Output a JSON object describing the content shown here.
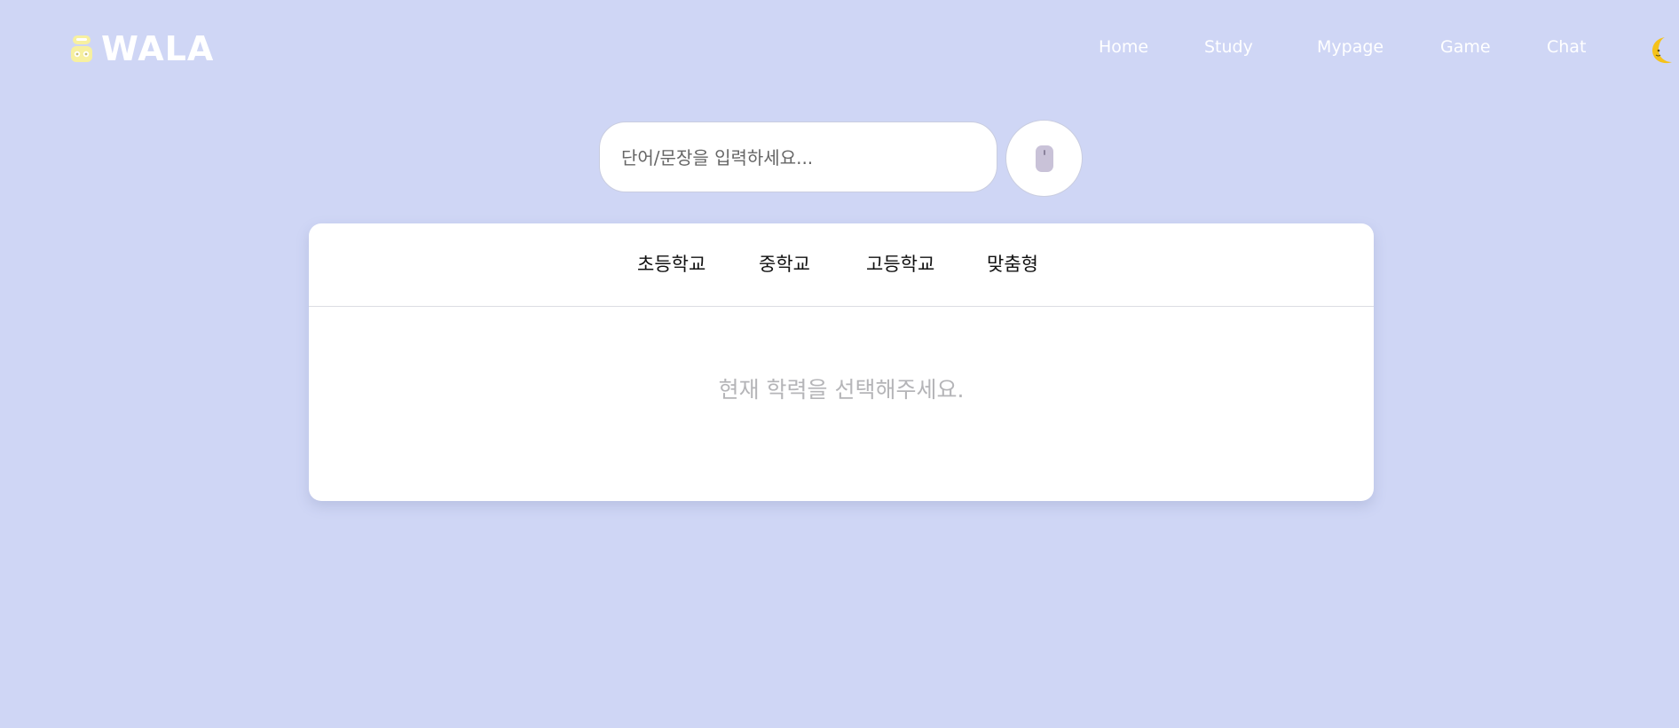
{
  "header": {
    "logo_text": "WALA",
    "nav": [
      {
        "label": "Home"
      },
      {
        "label": "Study"
      },
      {
        "label": "Mypage"
      },
      {
        "label": "Game"
      },
      {
        "label": "Chat"
      }
    ]
  },
  "search": {
    "placeholder": "단어/문장을 입력하세요...",
    "value": ""
  },
  "level_tabs": [
    {
      "label": "초등학교"
    },
    {
      "label": "중학교"
    },
    {
      "label": "고등학교"
    },
    {
      "label": "맞춤형"
    }
  ],
  "empty_message": "현재 학력을 선택해주세요.",
  "icons": {
    "logo": "robot-icon",
    "theme_toggle": "moon-icon",
    "voice": "microphone-icon"
  },
  "colors": {
    "background": "#cfd6f5",
    "card": "#ffffff",
    "nav_text": "#ffffff",
    "logo_accent": "#f7f0a0",
    "moon": "#f5c21a"
  }
}
